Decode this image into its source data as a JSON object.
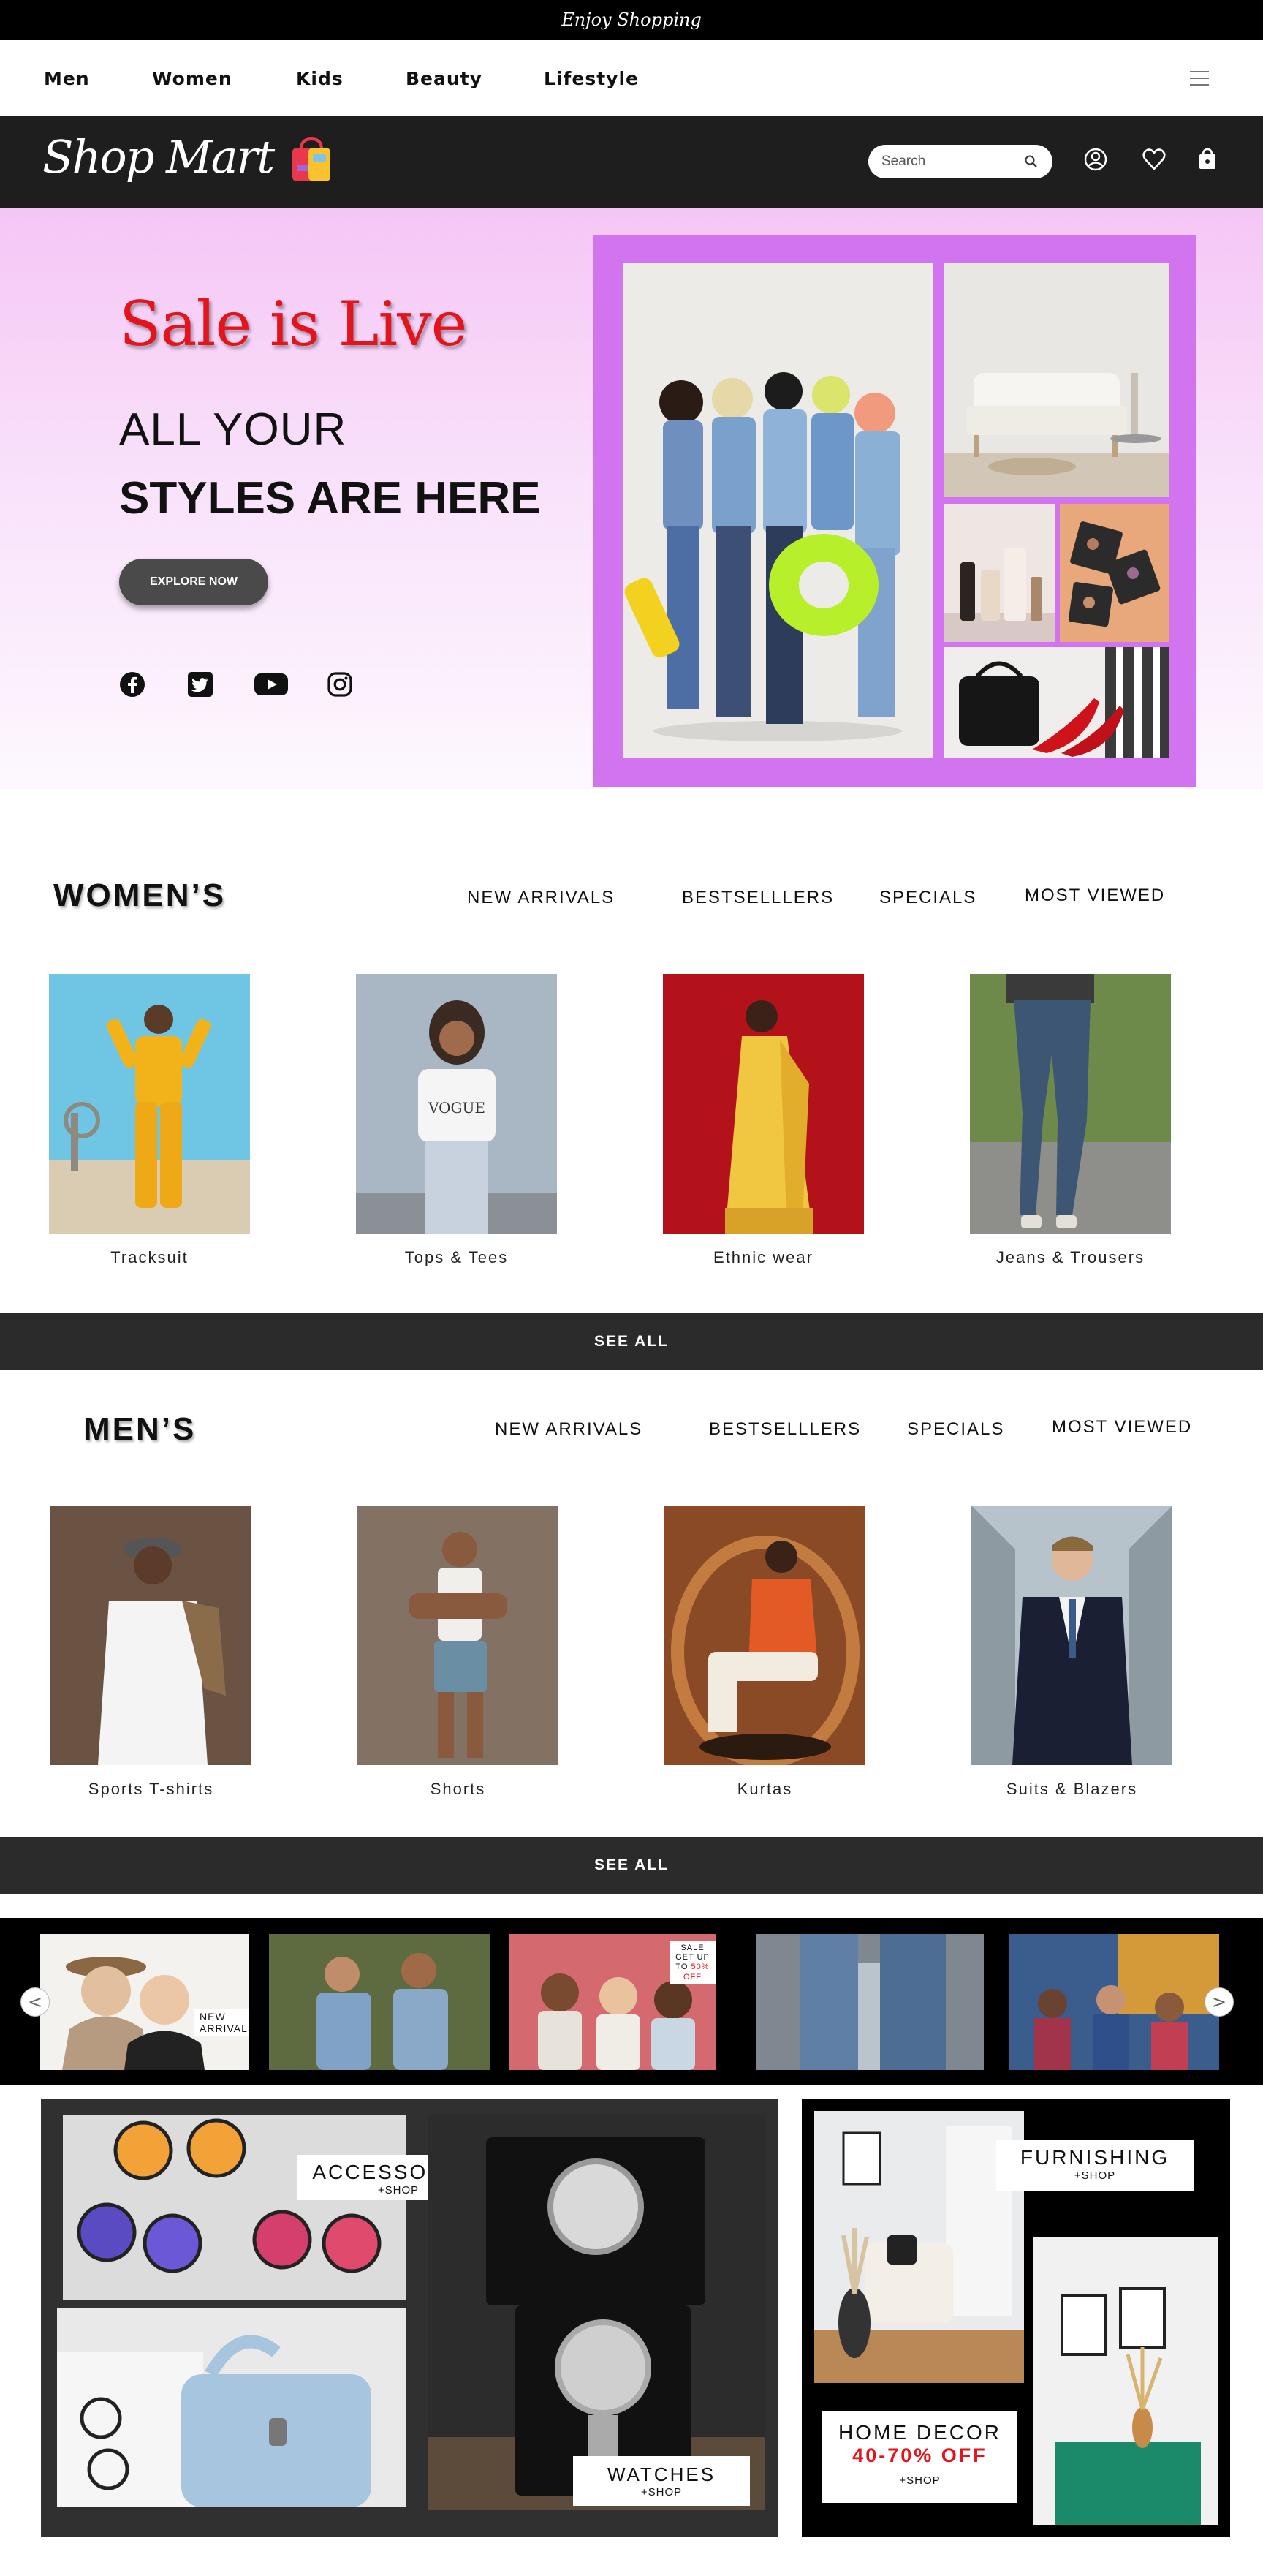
{
  "topbar": {
    "tagline": "Enjoy Shopping"
  },
  "nav": {
    "links": [
      "Men",
      "Women",
      "Kids",
      "Beauty",
      "Lifestyle"
    ]
  },
  "brand": {
    "name": "Shop Mart"
  },
  "header": {
    "search_placeholder": "Search"
  },
  "hero": {
    "sale_title": "Sale is Live",
    "line1": "ALL YOUR",
    "line2": "STYLES ARE HERE",
    "cta": "EXPLORE NOW"
  },
  "womens": {
    "title": "WOMEN’S",
    "tabs": [
      "NEW ARRIVALS",
      "BESTSELLLERS",
      "SPECIALS",
      "MOST VIEWED"
    ],
    "items": [
      "Tracksuit",
      "Tops & Tees",
      "Ethnic wear",
      "Jeans & Trousers"
    ],
    "see_all": "SEE ALL"
  },
  "mens": {
    "title": "MEN’S",
    "tabs": [
      "NEW ARRIVALS",
      "BESTSELLLERS",
      "SPECIALS",
      "MOST VIEWED"
    ],
    "items": [
      "Sports T-shirts",
      "Shorts",
      "Kurtas",
      "Suits & Blazers"
    ],
    "see_all": "SEE ALL"
  },
  "carousel": {
    "prev": "<",
    "next": ">",
    "tag_new": "NEW ARRIVALS",
    "tag_sale_top": "SALE",
    "tag_sale_bottom": "GET UP TO",
    "tag_sale_pct": "50% OFF"
  },
  "promos": {
    "accessories": {
      "title": "ACCESSORIES",
      "sub": "+SHOP"
    },
    "watches": {
      "title": "WATCHES",
      "sub": "+SHOP"
    },
    "furnishing": {
      "title": "FURNISHING",
      "sub": "+SHOP"
    },
    "home_decor": {
      "title": "HOME DECOR",
      "discount": "40-70% OFF",
      "sub": "+SHOP"
    }
  },
  "colors": {
    "accent_red": "#e4141c",
    "collage_purple": "#d273ef",
    "dark_bar": "#1f1e1f"
  }
}
